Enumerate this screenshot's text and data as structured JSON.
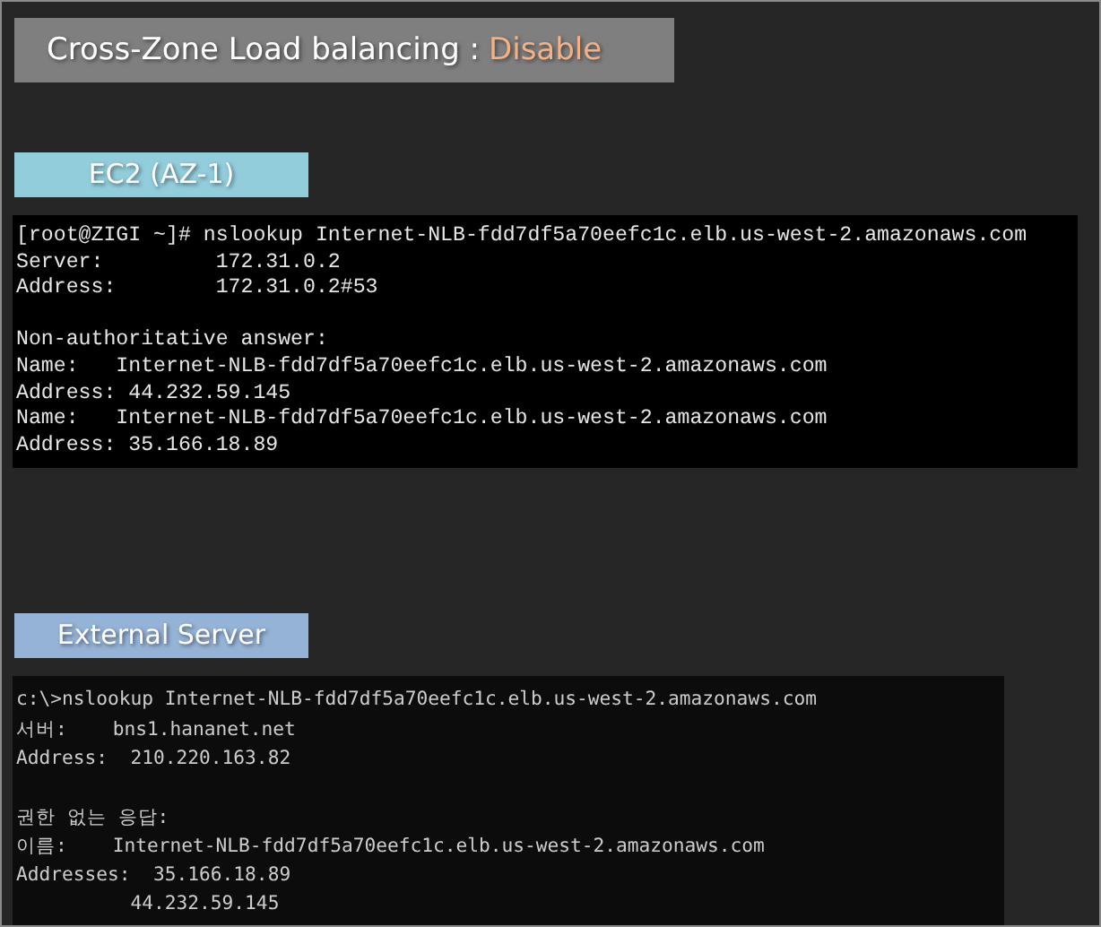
{
  "header": {
    "label": "Cross-Zone Load balancing :",
    "value": "Disable"
  },
  "sections": [
    {
      "kind": "linux",
      "label": "EC2 (AZ-1)",
      "blocks": [
        [
          "[root@ZIGI ~]# nslookup Internet-NLB-fdd7df5a70eefc1c.elb.us-west-2.amazonaws.com",
          "Server:         172.31.0.2",
          "Address:        172.31.0.2#53"
        ],
        [
          "Non-authoritative answer:",
          "Name:   Internet-NLB-fdd7df5a70eefc1c.elb.us-west-2.amazonaws.com",
          "Address: 44.232.59.145",
          "Name:   Internet-NLB-fdd7df5a70eefc1c.elb.us-west-2.amazonaws.com",
          "Address: 35.166.18.89"
        ]
      ]
    },
    {
      "kind": "windows",
      "label": "External Server",
      "blocks": [
        [
          "c:\\>nslookup Internet-NLB-fdd7df5a70eefc1c.elb.us-west-2.amazonaws.com",
          "서버:    bns1.hananet.net",
          "Address:  210.220.163.82"
        ],
        [
          "권한 없는 응답:",
          "이름:    Internet-NLB-fdd7df5a70eefc1c.elb.us-west-2.amazonaws.com",
          "Addresses:  35.166.18.89",
          "          44.232.59.145"
        ]
      ]
    }
  ]
}
